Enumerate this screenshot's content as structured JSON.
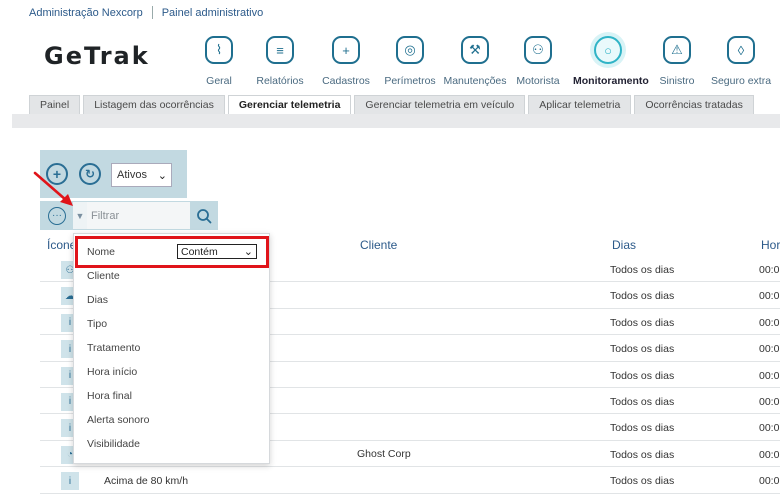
{
  "breadcrumb": {
    "company": "Administração Nexcorp",
    "panel": "Painel administrativo"
  },
  "logo": "GeTrak",
  "modules": [
    {
      "label": "Geral",
      "icon": "monitor-chart-icon",
      "glyph": "⌇"
    },
    {
      "label": "Relatórios",
      "icon": "report-list-icon",
      "glyph": "≡"
    },
    {
      "label": "Cadastros",
      "icon": "folder-plus-icon",
      "glyph": "+"
    },
    {
      "label": "Perímetros",
      "icon": "target-icon",
      "glyph": "◎"
    },
    {
      "label": "Manutenções",
      "icon": "wrench-icon",
      "glyph": "⚒"
    },
    {
      "label": "Motorista",
      "icon": "driver-icon",
      "glyph": "⚇"
    },
    {
      "label": "Monitoramento",
      "icon": "monitoring-icon",
      "glyph": "○"
    },
    {
      "label": "Sinistro",
      "icon": "alarm-icon",
      "glyph": "⚠"
    },
    {
      "label": "Seguro extra",
      "icon": "shield-icon",
      "glyph": "◊"
    }
  ],
  "active_module": "Monitoramento",
  "tabs": [
    {
      "label": "Painel"
    },
    {
      "label": "Listagem das ocorrências"
    },
    {
      "label": "Gerenciar telemetria"
    },
    {
      "label": "Gerenciar telemetria em veículo"
    },
    {
      "label": "Aplicar telemetria"
    },
    {
      "label": "Ocorrências tratadas"
    }
  ],
  "active_tab": "Gerenciar telemetria",
  "toolbar": {
    "status_value": "Ativos",
    "filter_placeholder": "Filtrar"
  },
  "table": {
    "headers": {
      "icon": "Ícone",
      "cliente": "Cliente",
      "dias": "Dias",
      "hora": "Hor"
    },
    "rows": [
      {
        "icon": "person-icon",
        "name": "",
        "cliente": "",
        "dias": "Todos os dias",
        "hora": "00:0"
      },
      {
        "icon": "cloud-icon",
        "name": "",
        "cliente": "",
        "dias": "Todos os dias",
        "hora": "00:0"
      },
      {
        "icon": "info-icon",
        "name": "",
        "cliente": "",
        "dias": "Todos os dias",
        "hora": "00:0"
      },
      {
        "icon": "info-icon",
        "name": "",
        "cliente": "",
        "dias": "Todos os dias",
        "hora": "00:0"
      },
      {
        "icon": "info-icon",
        "name": "",
        "cliente": "",
        "dias": "Todos os dias",
        "hora": "00:0"
      },
      {
        "icon": "info-icon",
        "name": "",
        "cliente": "",
        "dias": "Todos os dias",
        "hora": "00:0"
      },
      {
        "icon": "info-icon",
        "name": "",
        "cliente": "",
        "dias": "Todos os dias",
        "hora": "00:0"
      },
      {
        "icon": "gauge-icon",
        "name": "",
        "cliente": "Ghost Corp",
        "dias": "Todos os dias",
        "hora": "00:0"
      },
      {
        "icon": "info-icon",
        "name": "Acima de 80 km/h",
        "cliente": "",
        "dias": "Todos os dias",
        "hora": "00:0"
      }
    ]
  },
  "filter_menu": {
    "first": {
      "label": "Nome",
      "operator": "Contém"
    },
    "items": [
      "Cliente",
      "Dias",
      "Tipo",
      "Tratamento",
      "Hora início",
      "Hora final",
      "Alerta sonoro",
      "Visibilidade"
    ]
  },
  "colors": {
    "accent": "#2a6e94",
    "toolbar_bg": "#c2d9e1",
    "highlight": "#e0141a",
    "active_module": "#2fb3c6"
  }
}
